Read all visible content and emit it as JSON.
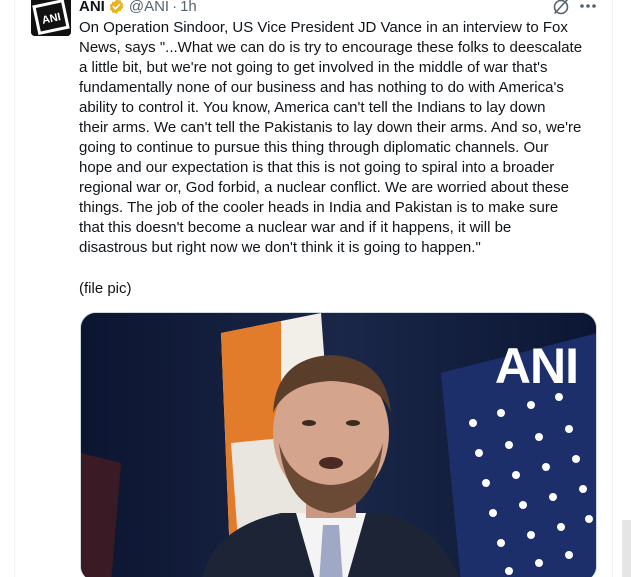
{
  "tweet": {
    "author_name": "ANI",
    "handle": "@ANI",
    "separator": "·",
    "time": "1h",
    "verified_color": "#e8b21f",
    "text_lines": [
      "On Operation Sindoor, US Vice President JD Vance in an interview to Fox",
      "News, says \"...What we can do is try to encourage these folks to deescalate",
      "a little bit, but we're not going to get involved in the middle of war that's",
      "fundamentally none of our business and has nothing to do with America's",
      "ability to control it. You know, America can't tell the Indians to lay down",
      "their arms. We can't tell the Pakistanis to lay down their arms. And so, we're",
      "going to continue to pursue this thing through diplomatic channels. Our",
      "hope and our expectation is that this is not going to spiral into a broader",
      "regional war or, God forbid, a nuclear conflict. We are worried about these",
      "things. The job of the cooler heads in India and Pakistan is to make sure",
      "that this doesn't become a nuclear war and if it happens, it will be",
      "disastrous but right now we don't think it is going to happen.\""
    ],
    "file_pic_note": "(file pic)",
    "media": {
      "watermark": "ANI"
    }
  },
  "avatar": {
    "logo_text": "ANI"
  },
  "icons": {
    "grok": "grok-icon",
    "more": "more-icon",
    "verified": "verified-badge-icon"
  }
}
